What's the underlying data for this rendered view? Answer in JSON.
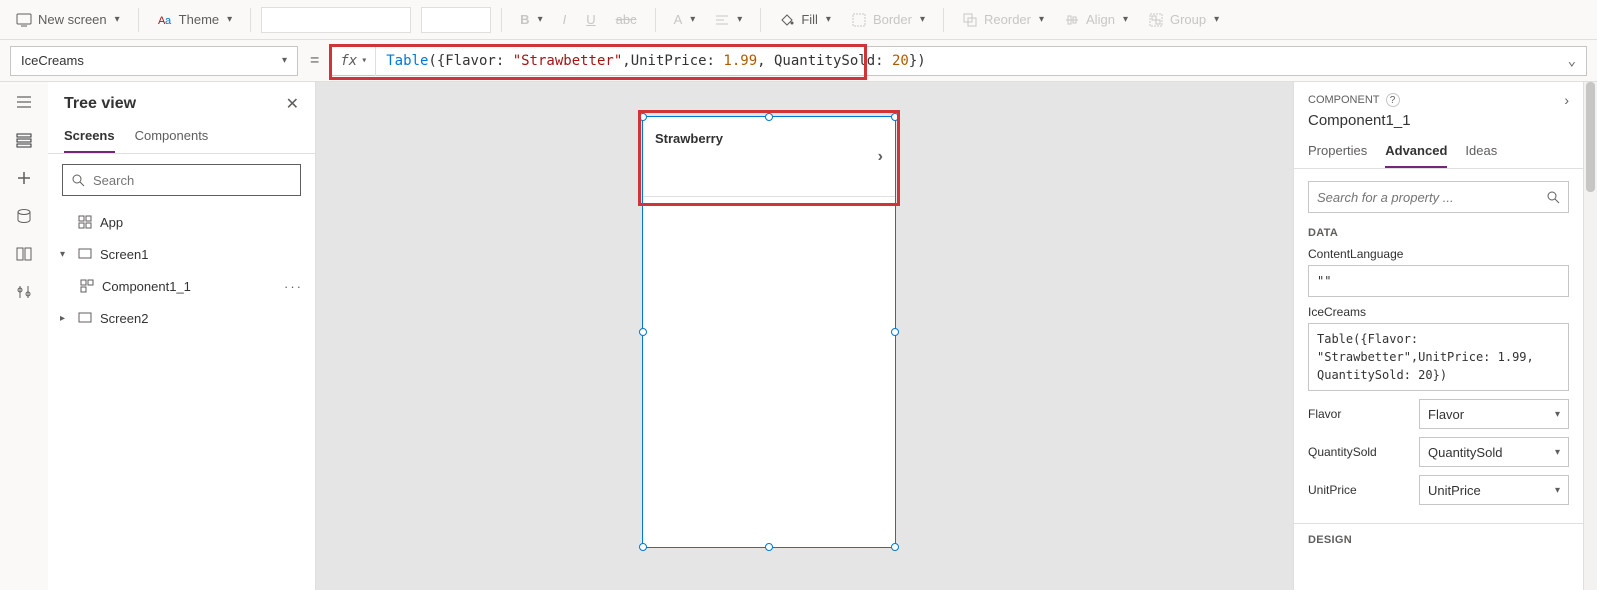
{
  "toolbar": {
    "newScreen": "New screen",
    "theme": "Theme",
    "fill": "Fill",
    "border": "Border",
    "reorder": "Reorder",
    "align": "Align",
    "group": "Group"
  },
  "formulaBar": {
    "property": "IceCreams",
    "formulaTokens": {
      "t1": "Table",
      "t2": "({Flavor: ",
      "t3": "\"Strawbetter\"",
      "t4": ",UnitPrice: ",
      "t5": "1.99",
      "t6": ", QuantitySold: ",
      "t7": "20",
      "t8": "})"
    }
  },
  "treeView": {
    "title": "Tree view",
    "tabs": {
      "screens": "Screens",
      "components": "Components"
    },
    "searchPlaceholder": "Search",
    "items": {
      "app": "App",
      "screen1": "Screen1",
      "component1_1": "Component1_1",
      "screen2": "Screen2"
    }
  },
  "canvas": {
    "galleryItemText": "Strawberry"
  },
  "rightPanel": {
    "headerLabel": "COMPONENT",
    "componentName": "Component1_1",
    "tabs": {
      "properties": "Properties",
      "advanced": "Advanced",
      "ideas": "Ideas"
    },
    "searchPlaceholder": "Search for a property ...",
    "sections": {
      "data": "DATA",
      "design": "DESIGN"
    },
    "fields": {
      "contentLanguage": {
        "label": "ContentLanguage",
        "value": "\"\""
      },
      "iceCreams": {
        "label": "IceCreams",
        "value": "Table({Flavor: \"Strawbetter\",UnitPrice: 1.99, QuantitySold: 20})"
      },
      "flavor": {
        "label": "Flavor",
        "value": "Flavor"
      },
      "quantitySold": {
        "label": "QuantitySold",
        "value": "QuantitySold"
      },
      "unitPrice": {
        "label": "UnitPrice",
        "value": "UnitPrice"
      }
    }
  }
}
